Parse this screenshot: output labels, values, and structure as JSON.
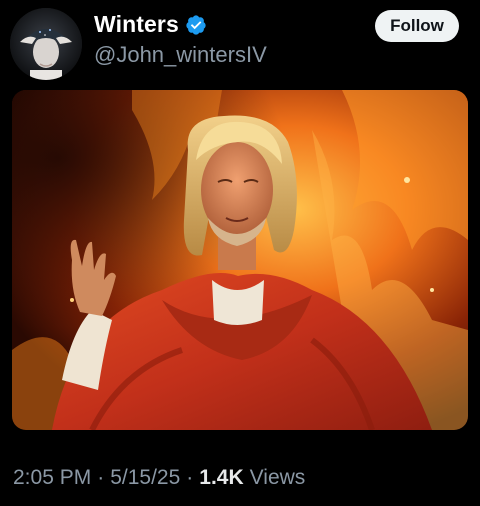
{
  "author": {
    "display_name": "Winters",
    "handle": "@John_wintersIV",
    "verified": true,
    "verified_badge_color": "#1d9bf0"
  },
  "follow_button": {
    "label": "Follow"
  },
  "media": {
    "description_icon": "ai-generated-image",
    "palette": {
      "fire": "#ff8a1a",
      "robe": "#c8331a",
      "background": "#3a0d02"
    }
  },
  "meta": {
    "time": "2:05 PM",
    "separator": "·",
    "date": "5/15/25",
    "views_count": "1.4K",
    "views_label": "Views"
  },
  "colors": {
    "background": "#000000",
    "secondary_text": "#8b98a5",
    "primary_text": "#e7e9ea"
  }
}
